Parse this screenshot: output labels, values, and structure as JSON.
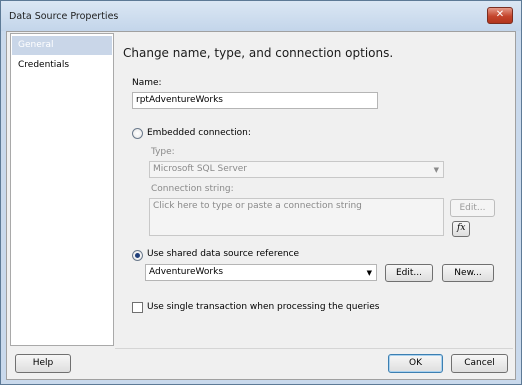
{
  "window": {
    "title": "Data Source Properties",
    "close_glyph": "✕"
  },
  "sidebar": {
    "items": [
      {
        "label": "General",
        "selected": true
      },
      {
        "label": "Credentials",
        "selected": false
      }
    ]
  },
  "main": {
    "heading": "Change name, type, and connection options.",
    "name_label": "Name:",
    "name_value": "rptAdventureWorks",
    "embedded": {
      "label": "Embedded connection:",
      "selected": false,
      "type_label": "Type:",
      "type_value": "Microsoft SQL Server",
      "connection_label": "Connection string:",
      "connection_placeholder": "Click here to type or paste a connection string",
      "edit_label": "Edit...",
      "fx_label": "fx"
    },
    "shared": {
      "label": "Use shared data source reference",
      "selected": true,
      "value": "AdventureWorks",
      "edit_label": "Edit...",
      "new_label": "New..."
    },
    "single_transaction": {
      "label": "Use single transaction when processing the queries",
      "checked": false
    }
  },
  "footer": {
    "help_label": "Help",
    "ok_label": "OK",
    "cancel_label": "Cancel"
  },
  "icons": {
    "dropdown": "chevron-down-icon",
    "close": "close-icon",
    "fx": "function-icon"
  },
  "colors": {
    "selected_nav": "#c9d6e8",
    "frame": "#c9d9ec",
    "close_button": "#c4452c"
  }
}
